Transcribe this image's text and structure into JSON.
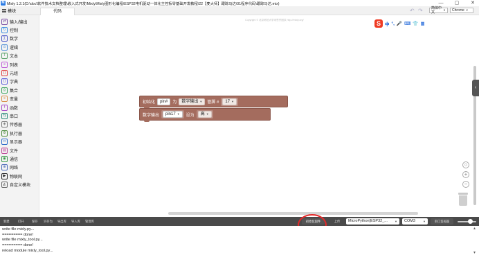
{
  "window": {
    "title": "Mixly 1.2.1(D:\\doc\\软件技术文档整理\\嵌入式开发\\Mixly\\Mixly图形化编程\\ESP32电机驱动一体化主控板零基础开发教程\\22【麦大师】跟踪马达\\01程序代码\\跟踪马达.mix)",
    "logo_letter": "M",
    "controls": [
      "—",
      "▢",
      "✕"
    ]
  },
  "toolbar": {
    "modules_tab": "模块",
    "code_tab": "代码",
    "undo_icon": "↶",
    "redo_icon": "↷",
    "language": "简体中文",
    "theme": "Chrome"
  },
  "sidebar": {
    "items": [
      {
        "label": "输入/输出",
        "icon": "io-icon",
        "glyph": "⇄",
        "color": "#7a4ea3"
      },
      {
        "label": "控制",
        "icon": "control-icon",
        "glyph": "↻",
        "color": "#3c8ee0"
      },
      {
        "label": "数学",
        "icon": "math-icon",
        "glyph": "∑",
        "color": "#4a58c8"
      },
      {
        "label": "逻辑",
        "icon": "logic-icon",
        "glyph": "⊙",
        "color": "#4f8fd6"
      },
      {
        "label": "文本",
        "icon": "text-icon",
        "glyph": "T",
        "color": "#5aa36a"
      },
      {
        "label": "列表",
        "icon": "list-icon",
        "glyph": "≡",
        "color": "#c05cd8"
      },
      {
        "label": "元组",
        "icon": "tuple-icon",
        "glyph": "()",
        "color": "#e04040"
      },
      {
        "label": "字典",
        "icon": "dict-icon",
        "glyph": "{}",
        "color": "#5c5cd8"
      },
      {
        "label": "集合",
        "icon": "set-icon",
        "glyph": "◎",
        "color": "#3aa35a"
      },
      {
        "label": "变量",
        "icon": "variable-icon",
        "glyph": "x",
        "color": "#d8904a"
      },
      {
        "label": "函数",
        "icon": "function-icon",
        "glyph": "f",
        "color": "#a64ac8"
      },
      {
        "label": "串口",
        "icon": "serial-icon",
        "glyph": "⇆",
        "color": "#2a8a7a"
      },
      {
        "label": "传感器",
        "icon": "sensor-icon",
        "glyph": "◈",
        "color": "#7a7a7a"
      },
      {
        "label": "执行器",
        "icon": "actuator-icon",
        "glyph": "⚙",
        "color": "#4a8a3a"
      },
      {
        "label": "显示器",
        "icon": "display-icon",
        "glyph": "▭",
        "color": "#2a6ac8"
      },
      {
        "label": "文件",
        "icon": "file-icon",
        "glyph": "▤",
        "color": "#c04a9a"
      },
      {
        "label": "通信",
        "icon": "communication-icon",
        "glyph": "◉",
        "color": "#3a9a4a"
      },
      {
        "label": "网络",
        "icon": "network-icon",
        "glyph": "⊕",
        "color": "#4a6ab8"
      },
      {
        "label": "物联网",
        "icon": "iot-icon",
        "glyph": "▶",
        "color": "#222222"
      },
      {
        "label": "自定义模块",
        "icon": "custom-module-icon",
        "glyph": "◭",
        "color": "#666666"
      }
    ]
  },
  "workspace": {
    "copyright": "Copyright © 北京师范大学米思齐团队 http://mixly.org/",
    "ime_logo": "S",
    "ime_items": [
      "中",
      "°,",
      "🎤",
      "⌨",
      "👕",
      "▦"
    ],
    "block_init": {
      "prefix": "初始化",
      "var": "pin#",
      "as": "为",
      "mode": "数字输出",
      "pin_label": "管脚 #",
      "pin": "17"
    },
    "block_output": {
      "prefix": "数字输出",
      "pin": "pin17",
      "set_as": "设为",
      "level": "高"
    },
    "zoom_in": "+",
    "zoom_reset": "○",
    "zoom_out": "−",
    "collapse": "‹"
  },
  "bottombar": {
    "buttons": [
      "新建",
      "打开",
      "保存",
      "另存为",
      "导出库",
      "导入库",
      "管理库"
    ],
    "init_firmware": "初始化固件",
    "upload": "上传",
    "board": "MicroPython[ESP32_...",
    "port": "COM3",
    "serial_monitor": "串口监视器"
  },
  "console": {
    "lines": [
      "write file mixly.py...",
      "========= done!",
      "write file mixly_tool.py...",
      "========= done!",
      "reload module mixly_tool.py..."
    ]
  }
}
